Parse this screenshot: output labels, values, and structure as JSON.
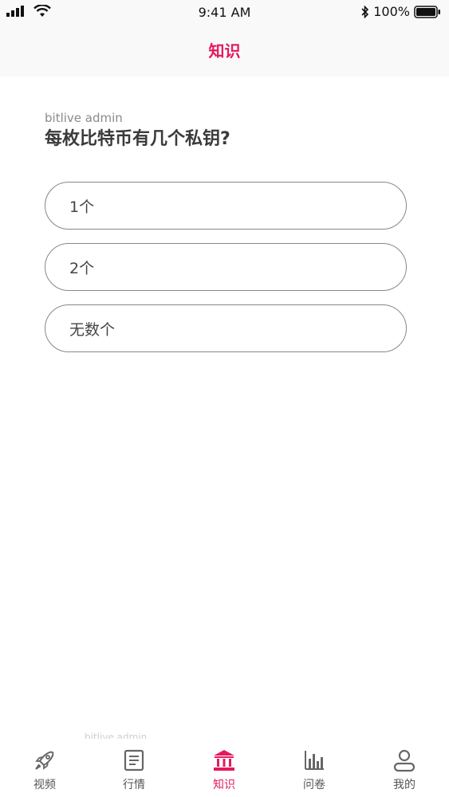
{
  "status_bar": {
    "time": "9:41 AM",
    "battery": "100%"
  },
  "nav": {
    "title": "知识"
  },
  "question": {
    "author": "bitlive admin",
    "text": "每枚比特币有几个私钥?"
  },
  "options": [
    {
      "label": "1个"
    },
    {
      "label": "2个"
    },
    {
      "label": "无数个"
    }
  ],
  "footer": {
    "watermark": "bitlive admin"
  },
  "tabs": [
    {
      "label": "视频",
      "icon": "rocket-icon"
    },
    {
      "label": "行情",
      "icon": "document-icon"
    },
    {
      "label": "知识",
      "icon": "bank-icon",
      "active": true
    },
    {
      "label": "问卷",
      "icon": "bar-chart-icon"
    },
    {
      "label": "我的",
      "icon": "user-icon"
    }
  ],
  "colors": {
    "accent": "#e5195e",
    "inactive": "#555555",
    "border": "#888888"
  }
}
